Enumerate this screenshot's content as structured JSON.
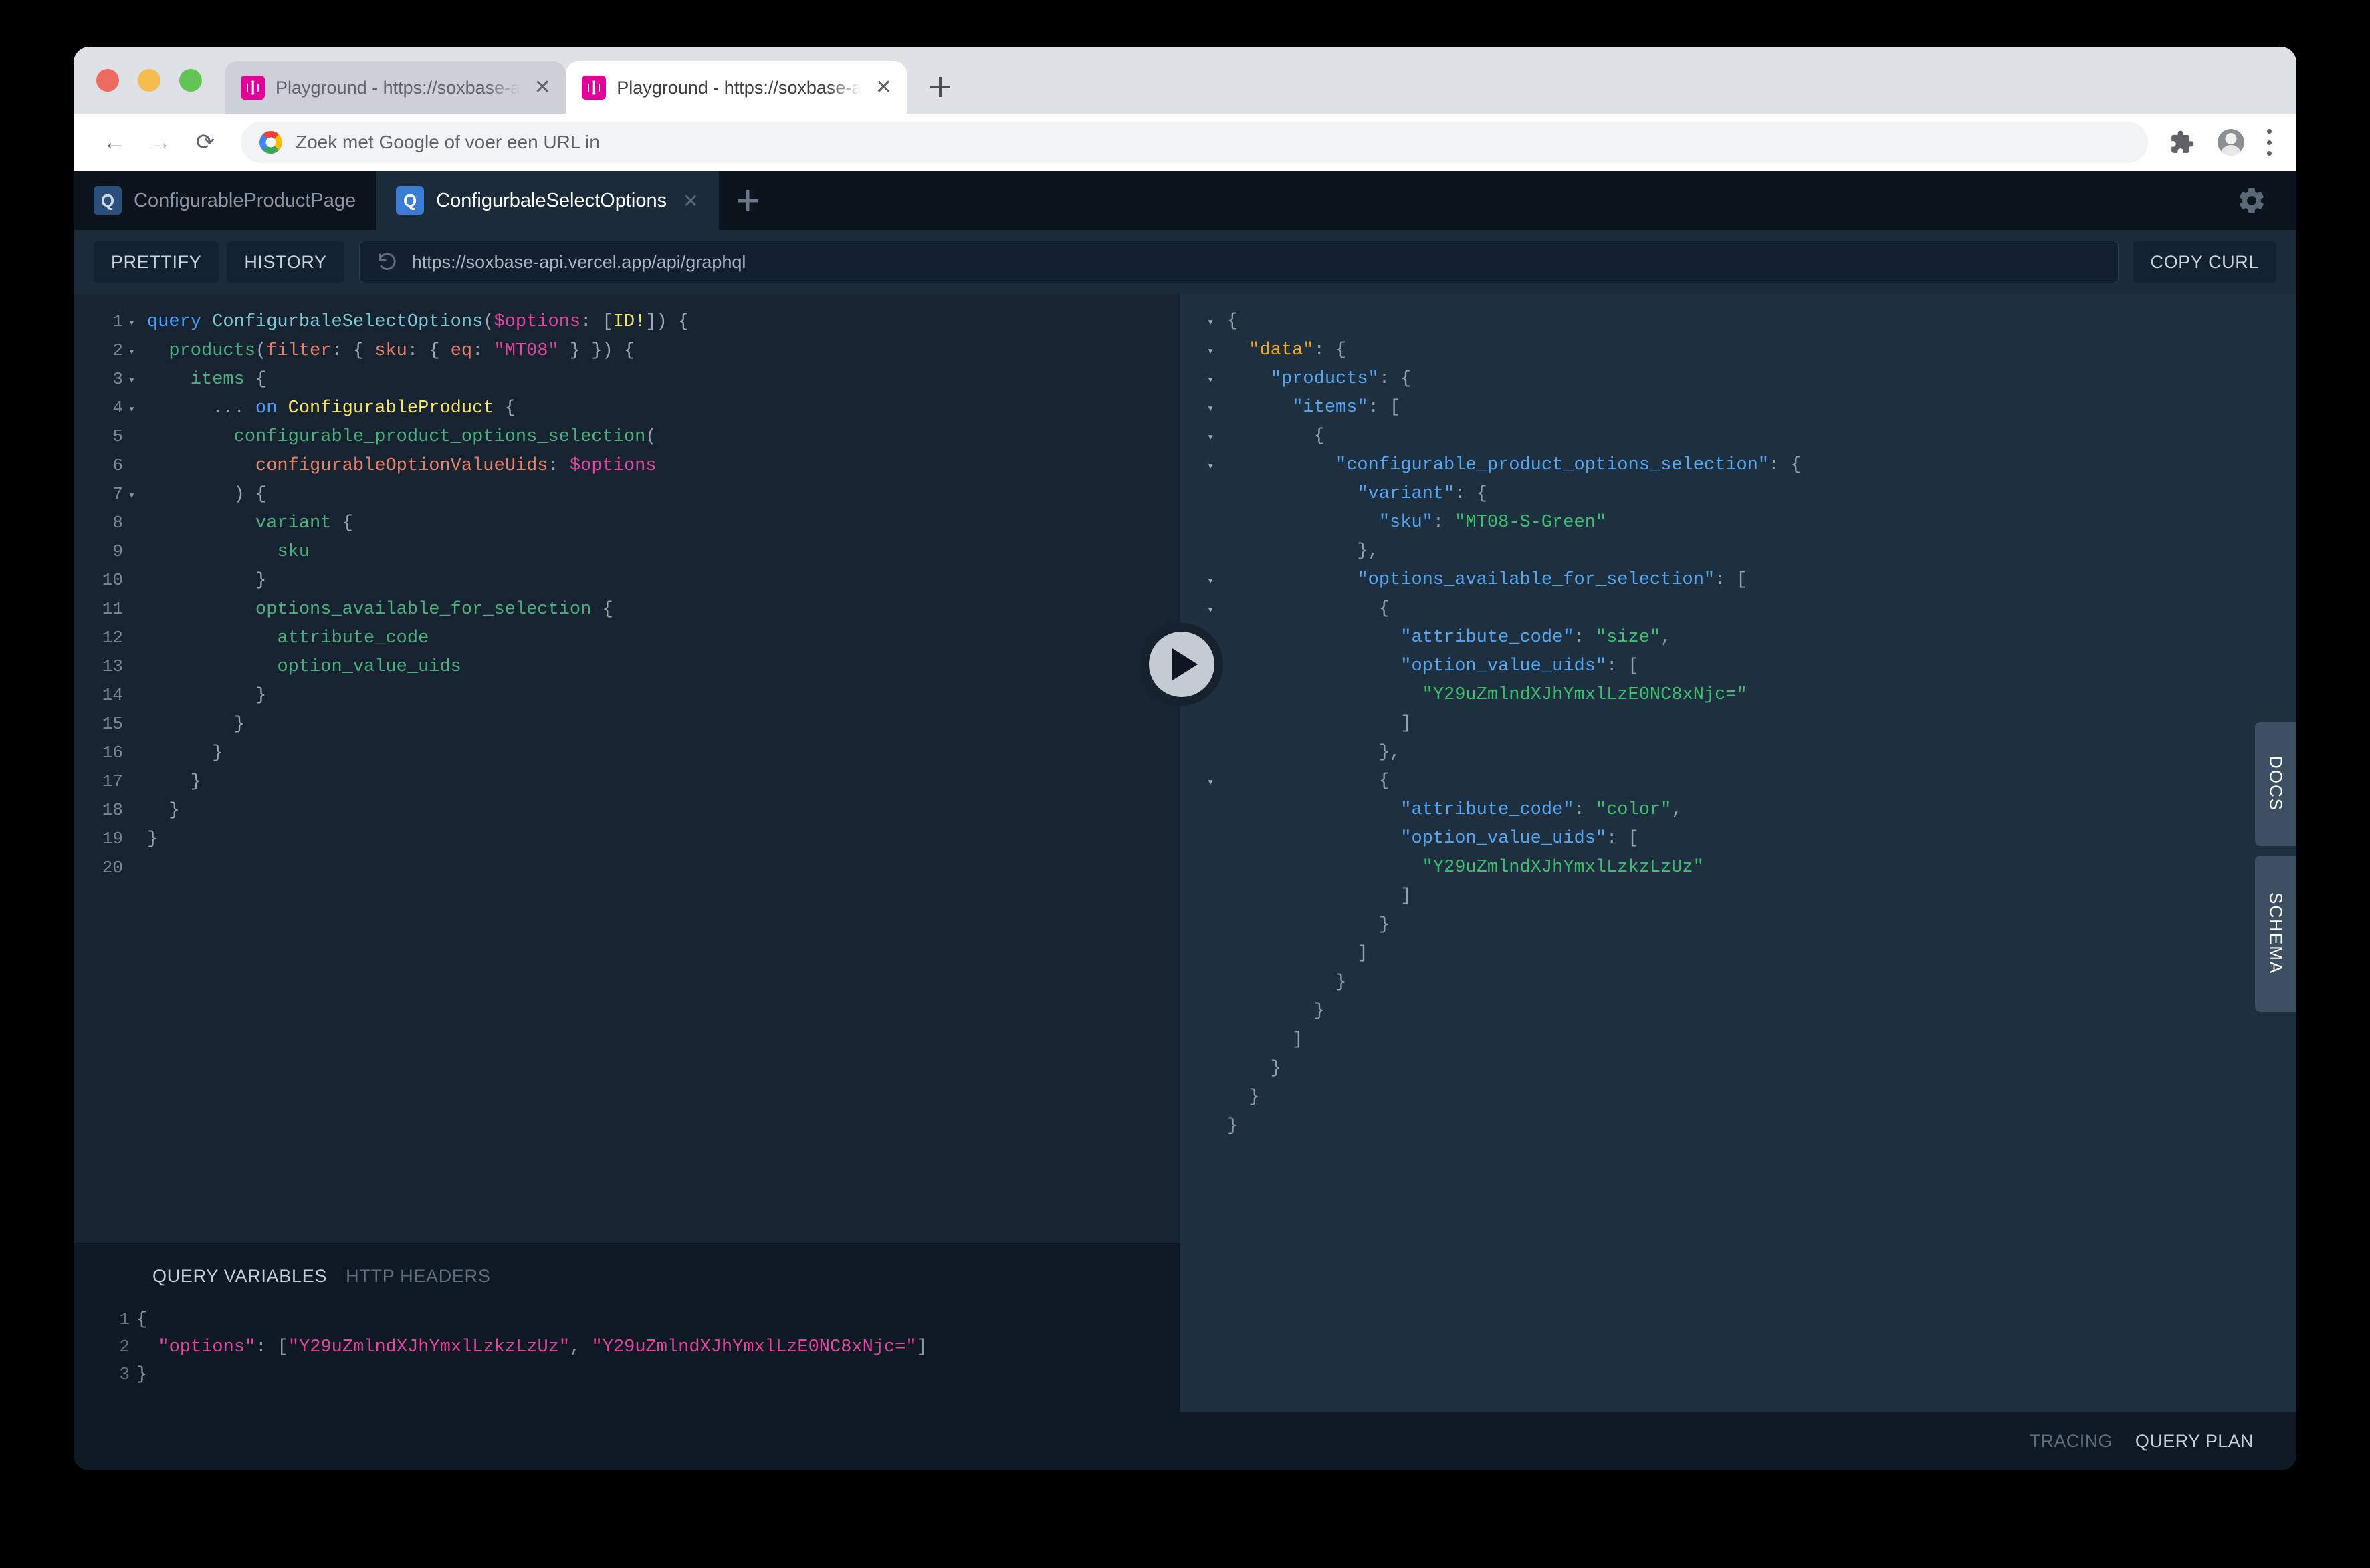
{
  "browser": {
    "tabs": [
      {
        "title": "Playground - https://soxbase-a",
        "favicon": "graphql-icon",
        "active": false
      },
      {
        "title": "Playground - https://soxbase-a",
        "favicon": "graphql-icon",
        "active": true
      }
    ],
    "new_tab_label": "+",
    "close_label": "✕",
    "omnibox": {
      "placeholder": "Zoek met Google of voer een URL in",
      "value": "Zoek met Google of voer een URL in"
    },
    "nav": {
      "back": "←",
      "forward": "→",
      "reload": "⟳"
    }
  },
  "playground": {
    "tabs": [
      {
        "badge": "Q",
        "label": "ConfigurableProductPage",
        "active": false
      },
      {
        "badge": "Q",
        "label": "ConfigurbaleSelectOptions",
        "active": true,
        "close": "✕"
      }
    ],
    "new_tab": "+",
    "toolbar": {
      "prettify": "PRETTIFY",
      "history": "HISTORY",
      "url": "https://soxbase-api.vercel.app/api/graphql",
      "copy_curl": "COPY CURL"
    },
    "side_tabs": [
      "DOCS",
      "SCHEMA"
    ],
    "footer": {
      "tracing": "TRACING",
      "query_plan": "QUERY PLAN"
    },
    "variables": {
      "tab_variables": "QUERY VARIABLES",
      "tab_headers": "HTTP HEADERS",
      "lines": [
        {
          "n": "1",
          "segments": [
            {
              "t": "{",
              "c": "t-vpun"
            }
          ]
        },
        {
          "n": "2",
          "segments": [
            {
              "t": "  ",
              "c": "t-vpun"
            },
            {
              "t": "\"options\"",
              "c": "t-vkey"
            },
            {
              "t": ": ",
              "c": "t-vpun"
            },
            {
              "t": "[",
              "c": "t-vpun"
            },
            {
              "t": "\"Y29uZmlndXJhYmxlLzkzLzUz\"",
              "c": "t-vstr"
            },
            {
              "t": ", ",
              "c": "t-vpun"
            },
            {
              "t": "\"Y29uZmlndXJhYmxlLzE0NC8xNjc=\"",
              "c": "t-vstr"
            },
            {
              "t": "]",
              "c": "t-vpun"
            }
          ]
        },
        {
          "n": "3",
          "segments": [
            {
              "t": "}",
              "c": "t-vpun"
            }
          ]
        }
      ]
    },
    "query": {
      "lines": [
        {
          "n": "1",
          "fold": "▾",
          "segments": [
            {
              "t": "query ",
              "c": "t-kw"
            },
            {
              "t": "ConfigurbaleSelectOptions",
              "c": "t-op"
            },
            {
              "t": "(",
              "c": "t-pun"
            },
            {
              "t": "$options",
              "c": "t-var"
            },
            {
              "t": ": ",
              "c": "t-pun"
            },
            {
              "t": "[",
              "c": "t-pun"
            },
            {
              "t": "ID!",
              "c": "t-type"
            },
            {
              "t": "]",
              "c": "t-pun"
            },
            {
              "t": ") {",
              "c": "t-pun"
            }
          ]
        },
        {
          "n": "2",
          "fold": "▾",
          "segments": [
            {
              "t": "  ",
              "c": "t-pun"
            },
            {
              "t": "products",
              "c": "t-field"
            },
            {
              "t": "(",
              "c": "t-pun"
            },
            {
              "t": "filter",
              "c": "t-arg"
            },
            {
              "t": ": { ",
              "c": "t-pun"
            },
            {
              "t": "sku",
              "c": "t-arg"
            },
            {
              "t": ": { ",
              "c": "t-pun"
            },
            {
              "t": "eq",
              "c": "t-arg"
            },
            {
              "t": ": ",
              "c": "t-pun"
            },
            {
              "t": "\"MT08\"",
              "c": "t-str"
            },
            {
              "t": " } }) {",
              "c": "t-pun"
            }
          ]
        },
        {
          "n": "3",
          "fold": "▾",
          "segments": [
            {
              "t": "    ",
              "c": "t-pun"
            },
            {
              "t": "items",
              "c": "t-field"
            },
            {
              "t": " {",
              "c": "t-pun"
            }
          ]
        },
        {
          "n": "4",
          "fold": "▾",
          "segments": [
            {
              "t": "      ... ",
              "c": "t-pun"
            },
            {
              "t": "on ",
              "c": "t-frag"
            },
            {
              "t": "ConfigurableProduct",
              "c": "t-type"
            },
            {
              "t": " {",
              "c": "t-pun"
            }
          ]
        },
        {
          "n": "5",
          "fold": "",
          "segments": [
            {
              "t": "        ",
              "c": "t-pun"
            },
            {
              "t": "configurable_product_options_selection",
              "c": "t-field"
            },
            {
              "t": "(",
              "c": "t-pun"
            }
          ]
        },
        {
          "n": "6",
          "fold": "",
          "segments": [
            {
              "t": "          ",
              "c": "t-pun"
            },
            {
              "t": "configurableOptionValueUids",
              "c": "t-arg"
            },
            {
              "t": ": ",
              "c": "t-pun"
            },
            {
              "t": "$options",
              "c": "t-var"
            }
          ]
        },
        {
          "n": "7",
          "fold": "▾",
          "segments": [
            {
              "t": "        ) {",
              "c": "t-pun"
            }
          ]
        },
        {
          "n": "8",
          "fold": "",
          "segments": [
            {
              "t": "          ",
              "c": "t-pun"
            },
            {
              "t": "variant",
              "c": "t-field"
            },
            {
              "t": " {",
              "c": "t-pun"
            }
          ]
        },
        {
          "n": "9",
          "fold": "",
          "segments": [
            {
              "t": "            ",
              "c": "t-pun"
            },
            {
              "t": "sku",
              "c": "t-field"
            }
          ]
        },
        {
          "n": "10",
          "fold": "",
          "segments": [
            {
              "t": "          }",
              "c": "t-pun"
            }
          ]
        },
        {
          "n": "11",
          "fold": "",
          "segments": [
            {
              "t": "          ",
              "c": "t-pun"
            },
            {
              "t": "options_available_for_selection",
              "c": "t-field"
            },
            {
              "t": " {",
              "c": "t-pun"
            }
          ]
        },
        {
          "n": "12",
          "fold": "",
          "segments": [
            {
              "t": "            ",
              "c": "t-pun"
            },
            {
              "t": "attribute_code",
              "c": "t-field"
            }
          ]
        },
        {
          "n": "13",
          "fold": "",
          "segments": [
            {
              "t": "            ",
              "c": "t-pun"
            },
            {
              "t": "option_value_uids",
              "c": "t-field"
            }
          ]
        },
        {
          "n": "14",
          "fold": "",
          "segments": [
            {
              "t": "          }",
              "c": "t-pun"
            }
          ]
        },
        {
          "n": "15",
          "fold": "",
          "segments": [
            {
              "t": "        }",
              "c": "t-pun"
            }
          ]
        },
        {
          "n": "16",
          "fold": "",
          "segments": [
            {
              "t": "      }",
              "c": "t-pun"
            }
          ]
        },
        {
          "n": "17",
          "fold": "",
          "segments": [
            {
              "t": "    }",
              "c": "t-pun"
            }
          ]
        },
        {
          "n": "18",
          "fold": "",
          "segments": [
            {
              "t": "  }",
              "c": "t-pun"
            }
          ]
        },
        {
          "n": "19",
          "fold": "",
          "segments": [
            {
              "t": "}",
              "c": "t-pun"
            }
          ]
        },
        {
          "n": "20",
          "fold": "",
          "segments": [
            {
              "t": "",
              "c": "t-pun"
            }
          ]
        }
      ]
    },
    "response": {
      "lines": [
        {
          "fold": "▾",
          "segments": [
            {
              "t": "{",
              "c": "j-pun"
            }
          ]
        },
        {
          "fold": "▾",
          "segments": [
            {
              "t": "  ",
              "c": "j-pun"
            },
            {
              "t": "\"data\"",
              "c": "j-root"
            },
            {
              "t": ": {",
              "c": "j-pun"
            }
          ]
        },
        {
          "fold": "▾",
          "segments": [
            {
              "t": "    ",
              "c": "j-pun"
            },
            {
              "t": "\"products\"",
              "c": "j-key"
            },
            {
              "t": ": {",
              "c": "j-pun"
            }
          ]
        },
        {
          "fold": "▾",
          "segments": [
            {
              "t": "      ",
              "c": "j-pun"
            },
            {
              "t": "\"items\"",
              "c": "j-key"
            },
            {
              "t": ": [",
              "c": "j-pun"
            }
          ]
        },
        {
          "fold": "▾",
          "segments": [
            {
              "t": "        {",
              "c": "j-pun"
            }
          ]
        },
        {
          "fold": "▾",
          "segments": [
            {
              "t": "          ",
              "c": "j-pun"
            },
            {
              "t": "\"configurable_product_options_selection\"",
              "c": "j-key"
            },
            {
              "t": ": {",
              "c": "j-pun"
            }
          ]
        },
        {
          "fold": "",
          "segments": [
            {
              "t": "            ",
              "c": "j-pun"
            },
            {
              "t": "\"variant\"",
              "c": "j-key"
            },
            {
              "t": ": {",
              "c": "j-pun"
            }
          ]
        },
        {
          "fold": "",
          "segments": [
            {
              "t": "              ",
              "c": "j-pun"
            },
            {
              "t": "\"sku\"",
              "c": "j-key"
            },
            {
              "t": ": ",
              "c": "j-pun"
            },
            {
              "t": "\"MT08-S-Green\"",
              "c": "j-str"
            }
          ]
        },
        {
          "fold": "",
          "segments": [
            {
              "t": "            },",
              "c": "j-pun"
            }
          ]
        },
        {
          "fold": "▾",
          "segments": [
            {
              "t": "            ",
              "c": "j-pun"
            },
            {
              "t": "\"options_available_for_selection\"",
              "c": "j-key"
            },
            {
              "t": ": [",
              "c": "j-pun"
            }
          ]
        },
        {
          "fold": "▾",
          "segments": [
            {
              "t": "              {",
              "c": "j-pun"
            }
          ]
        },
        {
          "fold": "",
          "segments": [
            {
              "t": "                ",
              "c": "j-pun"
            },
            {
              "t": "\"attribute_code\"",
              "c": "j-key"
            },
            {
              "t": ": ",
              "c": "j-pun"
            },
            {
              "t": "\"size\"",
              "c": "j-str"
            },
            {
              "t": ",",
              "c": "j-pun"
            }
          ]
        },
        {
          "fold": "",
          "segments": [
            {
              "t": "                ",
              "c": "j-pun"
            },
            {
              "t": "\"option_value_uids\"",
              "c": "j-key"
            },
            {
              "t": ": [",
              "c": "j-pun"
            }
          ]
        },
        {
          "fold": "",
          "segments": [
            {
              "t": "                  ",
              "c": "j-pun"
            },
            {
              "t": "\"Y29uZmlndXJhYmxlLzE0NC8xNjc=\"",
              "c": "j-str"
            }
          ]
        },
        {
          "fold": "",
          "segments": [
            {
              "t": "                ]",
              "c": "j-pun"
            }
          ]
        },
        {
          "fold": "",
          "segments": [
            {
              "t": "              },",
              "c": "j-pun"
            }
          ]
        },
        {
          "fold": "▾",
          "segments": [
            {
              "t": "              {",
              "c": "j-pun"
            }
          ]
        },
        {
          "fold": "",
          "segments": [
            {
              "t": "                ",
              "c": "j-pun"
            },
            {
              "t": "\"attribute_code\"",
              "c": "j-key"
            },
            {
              "t": ": ",
              "c": "j-pun"
            },
            {
              "t": "\"color\"",
              "c": "j-str"
            },
            {
              "t": ",",
              "c": "j-pun"
            }
          ]
        },
        {
          "fold": "",
          "segments": [
            {
              "t": "                ",
              "c": "j-pun"
            },
            {
              "t": "\"option_value_uids\"",
              "c": "j-key"
            },
            {
              "t": ": [",
              "c": "j-pun"
            }
          ]
        },
        {
          "fold": "",
          "segments": [
            {
              "t": "                  ",
              "c": "j-pun"
            },
            {
              "t": "\"Y29uZmlndXJhYmxlLzkzLzUz\"",
              "c": "j-str"
            }
          ]
        },
        {
          "fold": "",
          "segments": [
            {
              "t": "                ]",
              "c": "j-pun"
            }
          ]
        },
        {
          "fold": "",
          "segments": [
            {
              "t": "              }",
              "c": "j-pun"
            }
          ]
        },
        {
          "fold": "",
          "segments": [
            {
              "t": "            ]",
              "c": "j-pun"
            }
          ]
        },
        {
          "fold": "",
          "segments": [
            {
              "t": "          }",
              "c": "j-pun"
            }
          ]
        },
        {
          "fold": "",
          "segments": [
            {
              "t": "        }",
              "c": "j-pun"
            }
          ]
        },
        {
          "fold": "",
          "segments": [
            {
              "t": "      ]",
              "c": "j-pun"
            }
          ]
        },
        {
          "fold": "",
          "segments": [
            {
              "t": "    }",
              "c": "j-pun"
            }
          ]
        },
        {
          "fold": "",
          "segments": [
            {
              "t": "  }",
              "c": "j-pun"
            }
          ]
        },
        {
          "fold": "",
          "segments": [
            {
              "t": "}",
              "c": "j-pun"
            }
          ]
        }
      ]
    }
  },
  "colors": {
    "browser_chrome": "#dee1e6",
    "playground_bg": "#0f1923",
    "editor_bg": "#172331",
    "response_bg": "#1e2f40",
    "tab_active": "#1c2b3a",
    "accent_blue": "#3a7bd5",
    "graphql_pink": "#e10098"
  }
}
